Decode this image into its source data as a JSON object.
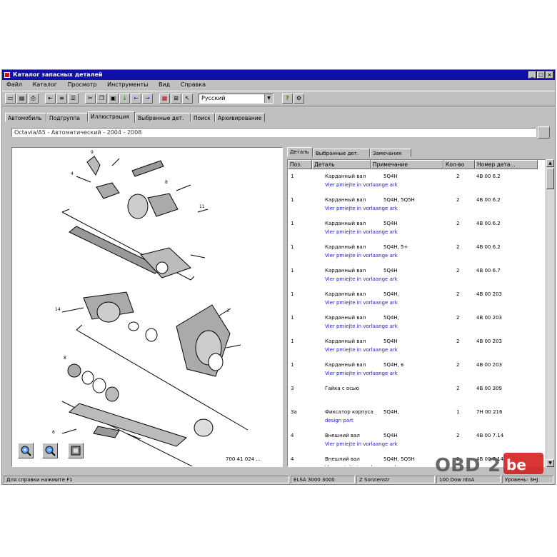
{
  "window": {
    "title": "Каталог запасных деталей",
    "buttons": [
      "_",
      "□",
      "×"
    ]
  },
  "menu": [
    "Файл",
    "Каталог",
    "Просмотр",
    "Инструменты",
    "Вид",
    "Справка"
  ],
  "toolbar": {
    "language": "Русский",
    "help_label": "?"
  },
  "tabs": [
    "Автомобиль",
    "Подгруппа",
    "Иллюстрация",
    "Выбранные дет.",
    "Поиск",
    "Архивирование"
  ],
  "active_tab": 2,
  "breadcrumb": "Octavia/A5 - Автоматический - 2004 - 2008",
  "drawing": {
    "caption": "700 41 024 ...",
    "zoom_in": "zoom-in",
    "zoom_out": "zoom-out",
    "fit": "fit"
  },
  "right_tabs": [
    "Деталь",
    "Выбранные дет.",
    "Замечания"
  ],
  "columns": [
    "Поз.",
    "Деталь",
    "Примечание",
    "Кол-во",
    "Номер дета..."
  ],
  "rows": [
    {
      "pos": "1",
      "part": "Карданный вал",
      "note": "5Q4H",
      "qty": "2",
      "num": "4B 00 6.2",
      "sub": "Vier pmiejte in vorlaange ark"
    },
    {
      "pos": "1",
      "part": "Карданный вал",
      "note": "5Q4H, 5Q5H",
      "qty": "2",
      "num": "4B 00 6.2",
      "sub": "Vier pmiejte in vorlaange ark"
    },
    {
      "pos": "1",
      "part": "Карданный вал",
      "note": "5Q4H",
      "qty": "2",
      "num": "4B 00 6.2",
      "sub": "Vier pmiejte in vorlaange ark"
    },
    {
      "pos": "1",
      "part": "Карданный вал",
      "note": "5Q4H, 5+",
      "qty": "2",
      "num": "4B 00 6.2",
      "sub": "Vier pmiejte in vorlaange ark"
    },
    {
      "pos": "1",
      "part": "Карданный вал",
      "note": "5Q4H",
      "qty": "2",
      "num": "4B 00 6.7",
      "sub": "Vier pmiejte in vorlaange ark"
    },
    {
      "pos": "1",
      "part": "Карданный вал",
      "note": "5Q4H,",
      "qty": "2",
      "num": "4B 00 203",
      "sub": "Vier pmiejte in vorlaange ark"
    },
    {
      "pos": "1",
      "part": "Карданный вал",
      "note": "5Q4H,",
      "qty": "2",
      "num": "4B 00 203",
      "sub": "Vier pmiejte in vorlaange ark"
    },
    {
      "pos": "1",
      "part": "Карданный вал",
      "note": "5Q4H",
      "qty": "2",
      "num": "4B 00 203",
      "sub": "Vier pmiejte in vorlaange ark"
    },
    {
      "pos": "1",
      "part": "Карданный вал",
      "note": "5Q4H, в",
      "qty": "2",
      "num": "4B 00 203",
      "sub": "Vier pmiejte in vorlaange ark"
    },
    {
      "pos": "3",
      "part": "Гайка с осью",
      "note": "",
      "qty": "2",
      "num": "4B 00 309",
      "sub": ""
    },
    {
      "pos": "3a",
      "part": "Фиксатор корпуса",
      "note": "5Q4H,",
      "qty": "1",
      "num": "7H 00 216",
      "sub": "design part"
    },
    {
      "pos": "4",
      "part": "Внешний вал",
      "note": "5Q4H",
      "qty": "2",
      "num": "4B 00 7.14",
      "sub": "Vier pmiejte in vorlaange ark"
    },
    {
      "pos": "4",
      "part": "Внешний вал",
      "note": "5Q4H, 5Q5H",
      "qty": "2",
      "num": "4B 00 7.14",
      "sub": "Vier pmiejte in vorlaange ark"
    }
  ],
  "status": {
    "left": "Для справки нажмите F1",
    "mid1": "ELSA 3000 3000",
    "mid2": "Z Sonnenstr",
    "mid3": "100 Dow ntoA",
    "right": "Уровень: 3HJ"
  },
  "watermark": "OBD2be"
}
